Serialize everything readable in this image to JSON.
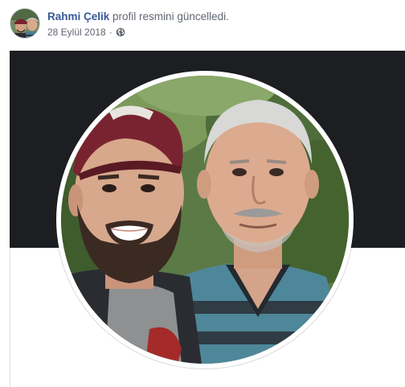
{
  "post": {
    "author_name": "Rahmi Çelik",
    "action_text": "profil resmini güncelledi.",
    "date": "28 Eylül 2018",
    "separator": "·",
    "privacy_icon": "globe-icon"
  },
  "images": {
    "avatar": "profile-thumbnail-two-men",
    "profile_photo": "selfie-young-man-with-cap-and-older-man"
  },
  "colors": {
    "author_link": "#385898",
    "cover_dark": "#1c1e21",
    "meta_text": "#606770"
  }
}
